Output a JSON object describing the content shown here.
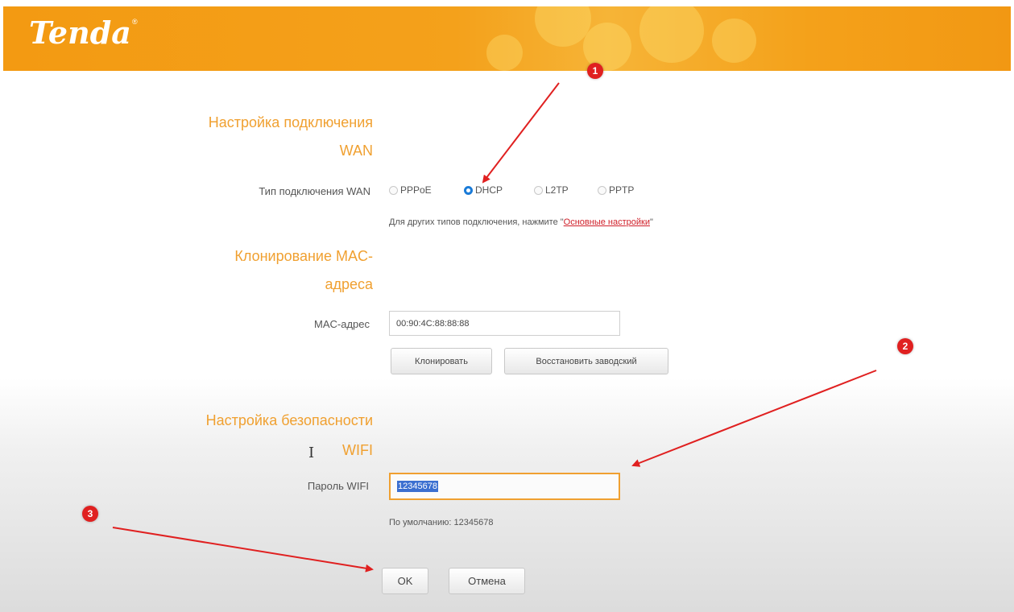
{
  "brand": {
    "logo_text": "Tenda",
    "registered_mark": "®"
  },
  "colors": {
    "header": "#f39a12",
    "section_title": "#f0a030",
    "link": "#d0202a",
    "radio_selected": "#1a7bd8",
    "badge": "#e02020",
    "arrow": "#e02020"
  },
  "wan": {
    "title_line1": "Настройка подключения",
    "title_line2": "WAN",
    "type_label": "Тип подключения WAN",
    "options": [
      "PPPoE",
      "DHCP",
      "L2TP",
      "PPTP"
    ],
    "selected": "DHCP",
    "hint_prefix": "Для других типов подключения, нажмите \"",
    "hint_link": "Основные настройки",
    "hint_suffix": "\""
  },
  "mac": {
    "title_line1": "Клонирование MAC-",
    "title_line2": "адреса",
    "label": "MAC-адрес",
    "value": "00:90:4C:88:88:88",
    "clone_button": "Клонировать",
    "restore_button": "Восстановить заводский"
  },
  "wifi": {
    "title_line1": "Настройка безопасности",
    "title_line2": "WIFI",
    "password_label": "Пароль WIFI",
    "password_value": "12345678",
    "default_hint": "По умолчанию: 12345678"
  },
  "actions": {
    "ok": "OK",
    "cancel": "Отмена"
  },
  "annotations": {
    "badge1": "1",
    "badge2": "2",
    "badge3": "3"
  },
  "cursor_glyph": "I"
}
